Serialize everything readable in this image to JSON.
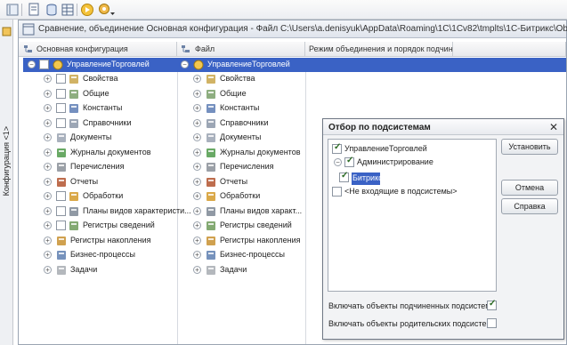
{
  "app": {
    "window_title": "Сравнение, объединение Основная конфигурация - Файл C:\\Users\\a.denisyuk\\AppData\\Roaming\\1C\\1Cv82\\tmplts\\1C-Битрикс\\Ob",
    "side_panel_label": "Конфигурация <1>"
  },
  "columns": {
    "main_config": "Основная конфигурация",
    "file": "Файл",
    "merge_mode": "Режим объединения и порядок подчин..."
  },
  "tree": {
    "root": "УправлениеТорговлей",
    "left_items": [
      "Свойства",
      "Общие",
      "Константы",
      "Справочники",
      "Документы",
      "Журналы документов",
      "Перечисления",
      "Отчеты",
      "Обработки",
      "Планы видов характеристи...",
      "Регистры сведений",
      "Регистры накопления",
      "Бизнес-процессы",
      "Задачи"
    ],
    "right_items": [
      "Свойства",
      "Общие",
      "Константы",
      "Справочники",
      "Документы",
      "Журналы документов",
      "Перечисления",
      "Отчеты",
      "Обработки",
      "Планы видов характ...",
      "Регистры сведений",
      "Регистры накопления",
      "Бизнес-процессы",
      "Задачи"
    ]
  },
  "dialog": {
    "title": "Отбор по подсистемам",
    "tree_root": "УправлениеТорговлей",
    "tree_admin": "Администрирование",
    "tree_bitrix": "Битрикс",
    "tree_none": "<Не входящие в подсистемы>",
    "btn_set": "Установить",
    "btn_cancel": "Отмена",
    "btn_help": "Справка",
    "opt_sub": "Включать объекты подчиненных подсистем",
    "opt_parent": "Включать объекты родительских подсистем"
  }
}
